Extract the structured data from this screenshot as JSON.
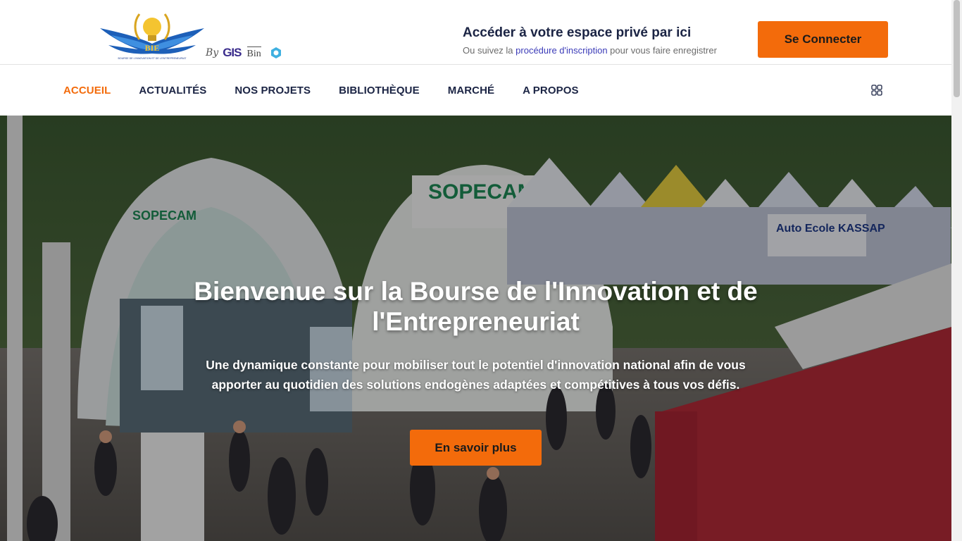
{
  "header": {
    "logo_name": "BIE",
    "logo_caption": "BOURSE DE L'INNOVATION ET DE L'ENTREPRENEURIAT",
    "by_label": "By",
    "gis_logo": "GIS",
    "bin_logo": "Bin",
    "access_title": "Accéder à votre espace privé par ici",
    "access_sub_prefix": "Ou suivez la ",
    "access_sub_link": "procédure d'inscription",
    "access_sub_suffix": " pour vous faire enregistrer",
    "connect_button": "Se Connecter"
  },
  "nav": {
    "items": [
      {
        "label": "ACCUEIL",
        "active": true
      },
      {
        "label": "ACTUALITÉS",
        "active": false
      },
      {
        "label": "NOS PROJETS",
        "active": false
      },
      {
        "label": "BIBLIOTHÈQUE",
        "active": false
      },
      {
        "label": "MARCHÉ",
        "active": false
      },
      {
        "label": "A PROPOS",
        "active": false
      }
    ],
    "menu_icon": "grid-icon"
  },
  "hero": {
    "title": "Bienvenue sur la Bourse de l'Innovation et de l'Entrepreneuriat",
    "subtitle": "Une dynamique constante pour mobiliser tout le potentiel d'innovation national afin de vous apporter au quotidien des solutions endogènes adaptées et compétitives à tous vos défis.",
    "button": "En savoir plus",
    "scene_signs": [
      "SOPECAM",
      "SOPECAM",
      "Auto Ecole KASSAP"
    ]
  },
  "colors": {
    "accent": "#f36b0b",
    "nav_text": "#1b2444",
    "link": "#3b3bb8"
  }
}
